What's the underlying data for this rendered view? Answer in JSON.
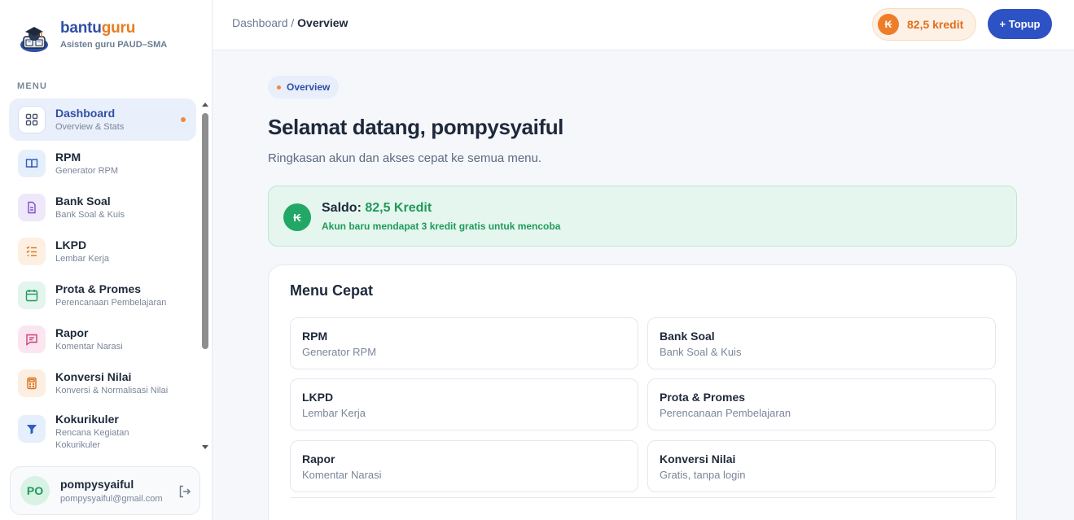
{
  "brand": {
    "name_part1": "bantu",
    "name_part2": "guru",
    "subtitle": "Asisten guru PAUD–SMA"
  },
  "sidebar": {
    "menu_label": "MENU",
    "items": [
      {
        "title": "Dashboard",
        "sub": "Overview & Stats",
        "icon": "grid-icon"
      },
      {
        "title": "RPM",
        "sub": "Generator RPM",
        "icon": "book-icon"
      },
      {
        "title": "Bank Soal",
        "sub": "Bank Soal & Kuis",
        "icon": "document-icon"
      },
      {
        "title": "LKPD",
        "sub": "Lembar Kerja",
        "icon": "checklist-icon"
      },
      {
        "title": "Prota & Promes",
        "sub": "Perencanaan Pembelajaran",
        "icon": "calendar-icon"
      },
      {
        "title": "Rapor",
        "sub": "Komentar Narasi",
        "icon": "chat-icon"
      },
      {
        "title": "Konversi Nilai",
        "sub": "Konversi & Normalisasi Nilai",
        "icon": "calculator-icon"
      },
      {
        "title": "Kokurikuler",
        "sub": "Rencana Kegiatan Kokurikuler",
        "icon": "filter-icon"
      }
    ]
  },
  "user": {
    "initials": "PO",
    "name": "pompysyaiful",
    "email": "pompysyaiful@gmail.com"
  },
  "topbar": {
    "breadcrumb_root": "Dashboard",
    "breadcrumb_sep": " / ",
    "breadcrumb_current": "Overview",
    "coin_symbol": "₭",
    "credit_label": "82,5 kredit",
    "topup_label": "+ Topup"
  },
  "main": {
    "badge": "Overview",
    "title": "Selamat datang, pompysyaiful",
    "subtitle": "Ringkasan akun dan akses cepat ke semua menu.",
    "saldo": {
      "symbol": "₭",
      "label": "Saldo: ",
      "value": "82,5 Kredit",
      "note": "Akun baru mendapat 3 kredit gratis untuk mencoba"
    },
    "quick": {
      "title": "Menu Cepat",
      "cards": [
        {
          "title": "RPM",
          "sub": "Generator RPM"
        },
        {
          "title": "Bank Soal",
          "sub": "Bank Soal & Kuis"
        },
        {
          "title": "LKPD",
          "sub": "Lembar Kerja"
        },
        {
          "title": "Prota & Promes",
          "sub": "Perencanaan Pembelajaran"
        },
        {
          "title": "Rapor",
          "sub": "Komentar Narasi"
        },
        {
          "title": "Konversi Nilai",
          "sub": "Gratis, tanpa login"
        }
      ]
    }
  },
  "colors": {
    "primary": "#2d52c4",
    "accent": "#ee7d2a",
    "success": "#22a766"
  }
}
